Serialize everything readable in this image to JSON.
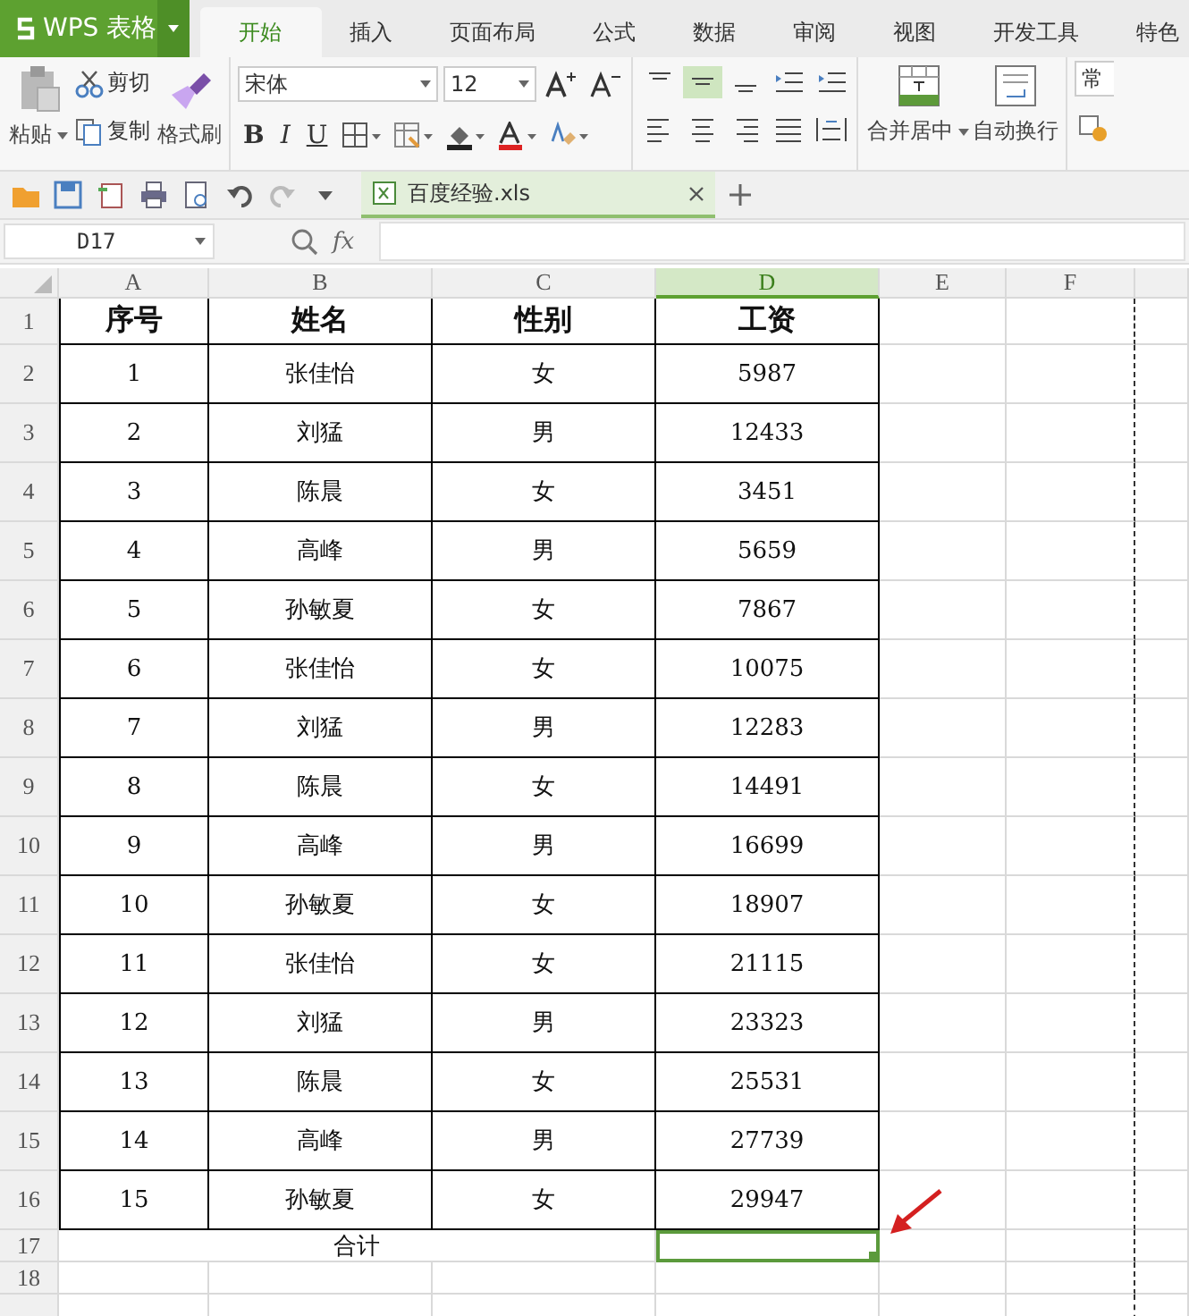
{
  "app_button": {
    "label": "WPS 表格"
  },
  "menu_tabs": [
    {
      "label": "开始",
      "selected": true
    },
    {
      "label": "插入",
      "selected": false
    },
    {
      "label": "页面布局",
      "selected": false
    },
    {
      "label": "公式",
      "selected": false
    },
    {
      "label": "数据",
      "selected": false
    },
    {
      "label": "审阅",
      "selected": false
    },
    {
      "label": "视图",
      "selected": false
    },
    {
      "label": "开发工具",
      "selected": false
    },
    {
      "label": "特色",
      "selected": false
    }
  ],
  "ribbon": {
    "paste": "粘贴",
    "cut": "剪切",
    "copy": "复制",
    "format_painter": "格式刷",
    "font_name": "宋体",
    "font_size": "12",
    "bold": "B",
    "italic": "I",
    "underline": "U",
    "vertical_align": [
      {
        "kind": "top",
        "selected": false
      },
      {
        "kind": "middle",
        "selected": true
      },
      {
        "kind": "bottom",
        "selected": false
      }
    ],
    "merge": "合并居中",
    "wrap": "自动换行",
    "number_format": "常"
  },
  "doc_tabs": [
    {
      "label": "百度经验.xls",
      "selected": true
    }
  ],
  "formula_bar": {
    "name_box": "D17",
    "fx": "fx"
  },
  "sheet": {
    "columns": [
      {
        "label": "A",
        "selected": false
      },
      {
        "label": "B",
        "selected": false
      },
      {
        "label": "C",
        "selected": false
      },
      {
        "label": "D",
        "selected": true
      },
      {
        "label": "E",
        "selected": false
      },
      {
        "label": "F",
        "selected": false
      }
    ],
    "rows": [
      {
        "number": "1",
        "kind": "header",
        "cells": [
          "序号",
          "姓名",
          "性别",
          "工资"
        ]
      },
      {
        "number": "2",
        "kind": "data",
        "cells": [
          "1",
          "张佳怡",
          "女",
          "5987"
        ]
      },
      {
        "number": "3",
        "kind": "data",
        "cells": [
          "2",
          "刘猛",
          "男",
          "12433"
        ]
      },
      {
        "number": "4",
        "kind": "data",
        "cells": [
          "3",
          "陈晨",
          "女",
          "3451"
        ]
      },
      {
        "number": "5",
        "kind": "data",
        "cells": [
          "4",
          "高峰",
          "男",
          "5659"
        ]
      },
      {
        "number": "6",
        "kind": "data",
        "cells": [
          "5",
          "孙敏夏",
          "女",
          "7867"
        ]
      },
      {
        "number": "7",
        "kind": "data",
        "cells": [
          "6",
          "张佳怡",
          "女",
          "10075"
        ]
      },
      {
        "number": "8",
        "kind": "data",
        "cells": [
          "7",
          "刘猛",
          "男",
          "12283"
        ]
      },
      {
        "number": "9",
        "kind": "data",
        "cells": [
          "8",
          "陈晨",
          "女",
          "14491"
        ]
      },
      {
        "number": "10",
        "kind": "data",
        "cells": [
          "9",
          "高峰",
          "男",
          "16699"
        ]
      },
      {
        "number": "11",
        "kind": "data",
        "cells": [
          "10",
          "孙敏夏",
          "女",
          "18907"
        ]
      },
      {
        "number": "12",
        "kind": "data",
        "cells": [
          "11",
          "张佳怡",
          "女",
          "21115"
        ]
      },
      {
        "number": "13",
        "kind": "data",
        "cells": [
          "12",
          "刘猛",
          "男",
          "23323"
        ]
      },
      {
        "number": "14",
        "kind": "data",
        "cells": [
          "13",
          "陈晨",
          "女",
          "25531"
        ]
      },
      {
        "number": "15",
        "kind": "data",
        "cells": [
          "14",
          "高峰",
          "男",
          "27739"
        ]
      },
      {
        "number": "16",
        "kind": "data",
        "cells": [
          "15",
          "孙敏夏",
          "女",
          "29947"
        ]
      },
      {
        "number": "17",
        "kind": "total",
        "label": "合计",
        "active": true
      },
      {
        "number": "18",
        "kind": "empty"
      }
    ]
  }
}
